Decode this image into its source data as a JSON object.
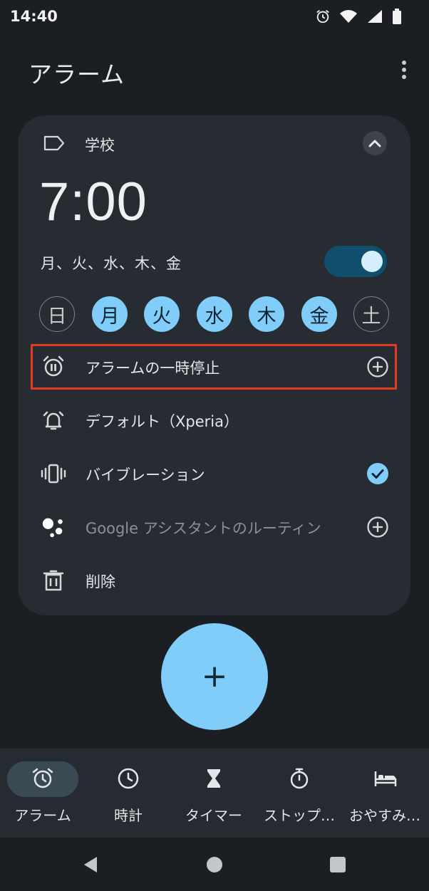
{
  "status_bar": {
    "time": "14:40",
    "icons": [
      "alarm-icon",
      "wifi-icon",
      "signal-icon",
      "battery-icon"
    ]
  },
  "header": {
    "title": "アラーム"
  },
  "alarm": {
    "label": "学校",
    "time": "7:00",
    "days_summary": "月、火、水、木、金",
    "enabled": true,
    "days": [
      {
        "label": "日",
        "selected": false
      },
      {
        "label": "月",
        "selected": true
      },
      {
        "label": "火",
        "selected": true
      },
      {
        "label": "水",
        "selected": true
      },
      {
        "label": "木",
        "selected": true
      },
      {
        "label": "金",
        "selected": true
      },
      {
        "label": "土",
        "selected": false
      }
    ],
    "options": {
      "pause": "アラームの一時停止",
      "sound": "デフォルト（Xperia）",
      "vibration": "バイブレーション",
      "vibration_checked": true,
      "assistant": "Google アシスタントのルーティン",
      "delete": "削除"
    }
  },
  "fab": {
    "symbol": "+"
  },
  "bottom_nav": {
    "items": [
      {
        "label": "アラーム",
        "active": true
      },
      {
        "label": "時計",
        "active": false
      },
      {
        "label": "タイマー",
        "active": false
      },
      {
        "label": "ストップ…",
        "active": false
      },
      {
        "label": "おやすみ…",
        "active": false
      }
    ]
  },
  "colors": {
    "background": "#1b1f23",
    "card": "#262c31",
    "accent": "#7fcdf8",
    "toggle_track": "#0f4f6b",
    "highlight": "#e23a22"
  }
}
